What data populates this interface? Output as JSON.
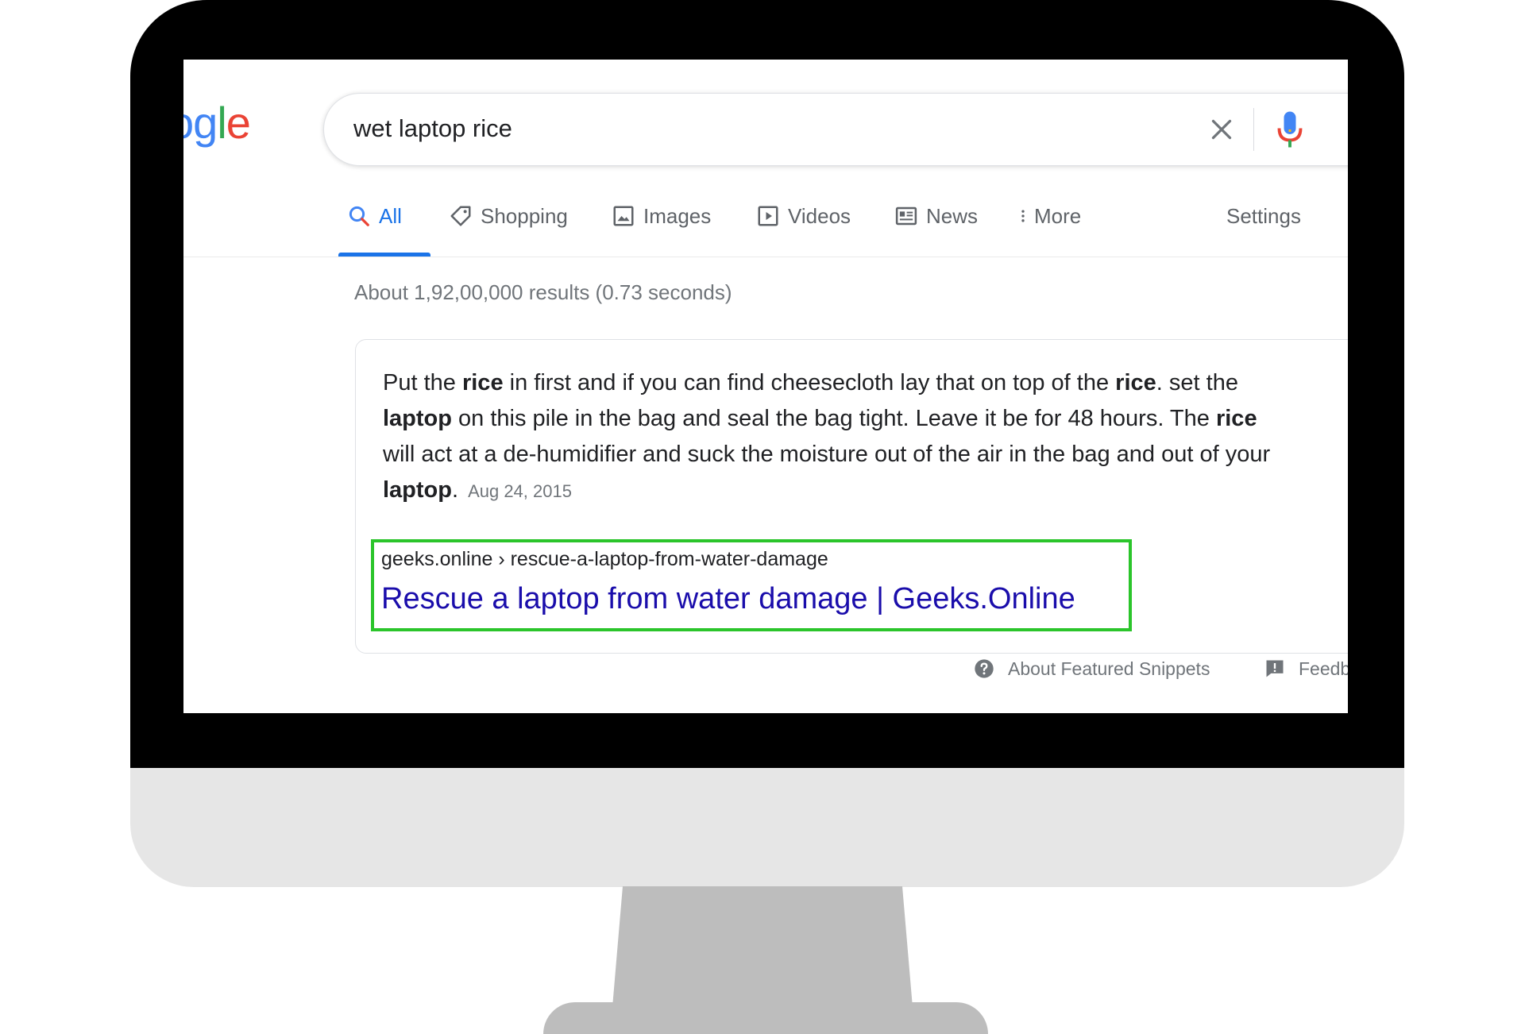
{
  "logo": {
    "text": "ogle"
  },
  "search": {
    "query": "wet laptop rice"
  },
  "tabs": [
    {
      "label": "All",
      "icon": "search-icon",
      "active": true
    },
    {
      "label": "Shopping",
      "icon": "tag-icon"
    },
    {
      "label": "Images",
      "icon": "image-icon"
    },
    {
      "label": "Videos",
      "icon": "play-icon"
    },
    {
      "label": "News",
      "icon": "newspaper-icon"
    },
    {
      "label": "More",
      "icon": "more-vert-icon"
    }
  ],
  "settings_label": "Settings",
  "result_stats": "About 1,92,00,000 results (0.73 seconds)",
  "snippet": {
    "line1": {
      "a": "Put the ",
      "b": "rice",
      "c": " in first and if you can find cheesecloth lay that on top of the ",
      "d": "rice",
      "e": ". set the"
    },
    "line2": {
      "a": "laptop",
      "b": " on this pile in the bag and seal the bag tight. Leave it be for 48 hours. The ",
      "c": "rice"
    },
    "line3": "will act at a de-humidifier and suck the moisture out of the air in the bag and out of your",
    "line4": {
      "a": "laptop",
      "b": "."
    },
    "date": "Aug 24, 2015",
    "breadcrumb": "geeks.online › rescue-a-laptop-from-water-damage",
    "title": "Rescue a laptop from water damage | Geeks.Online"
  },
  "footer": {
    "about_label": "About Featured Snippets",
    "feedback_label": "Feedback"
  },
  "colors": {
    "link": "#1a0dab",
    "active_tab": "#1a73e8",
    "highlight_box": "#2bc52b",
    "monitor_frame": "#000000",
    "monitor_chin": "#e6e6e6",
    "stand": "#bdbdbd"
  }
}
